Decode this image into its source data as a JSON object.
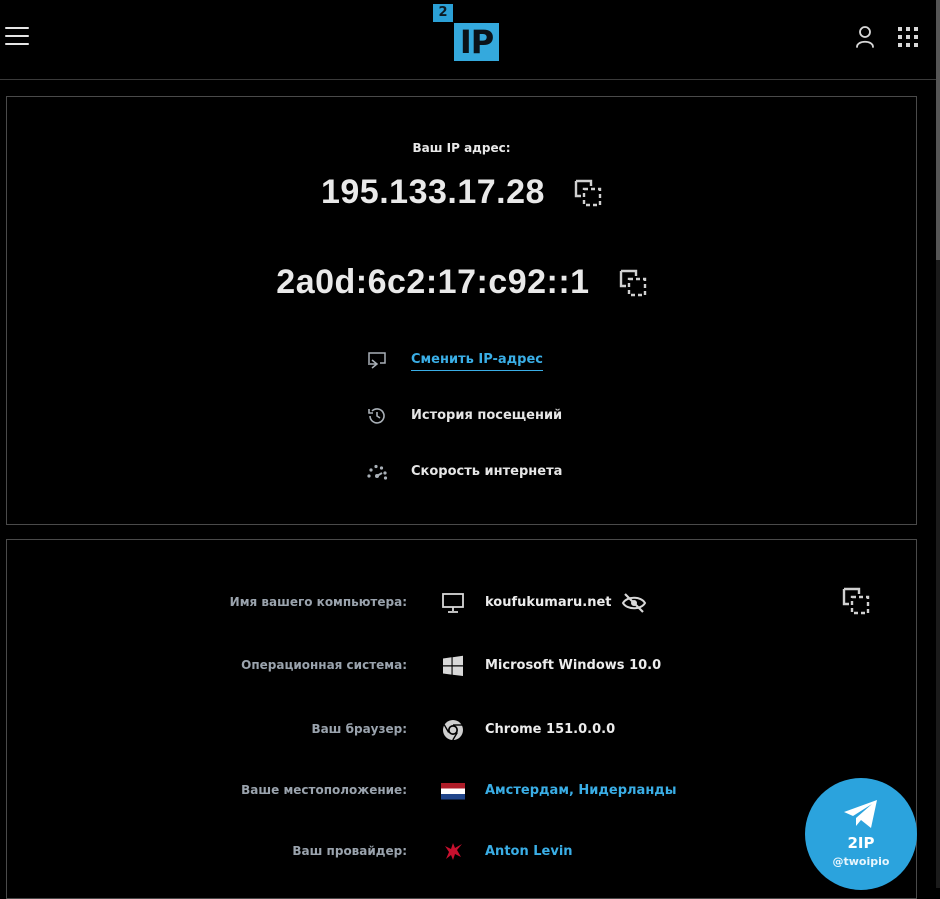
{
  "header": {
    "logo": {
      "small": "2",
      "big": "IP"
    }
  },
  "ip_block": {
    "label": "Ваш IP адрес:",
    "ipv4": "195.133.17.28",
    "ipv6": "2a0d:6c2:17:c92::1",
    "menu": [
      {
        "icon": "change-ip-icon",
        "label": "Сменить IP-адрес"
      },
      {
        "icon": "history-icon",
        "label": "История посещений"
      },
      {
        "icon": "speedometer-icon",
        "label": "Скорость интернета"
      }
    ]
  },
  "info": {
    "rows": [
      {
        "label": "Имя вашего компьютера:",
        "icon": "monitor-icon",
        "value": "koufukumaru.net"
      },
      {
        "label": "Операционная система:",
        "icon": "windows-icon",
        "value": "Microsoft Windows 10.0"
      },
      {
        "label": "Ваш браузер:",
        "icon": "chrome-icon",
        "value": "Chrome 151.0.0.0"
      },
      {
        "label": "Ваше местоположение:",
        "icon": "netherlands-flag-icon",
        "value": "Амстердам, Нидерланды"
      },
      {
        "label": "Ваш провайдер:",
        "icon": "provider-logo-icon",
        "value": "Anton Levin"
      }
    ]
  },
  "telegram": {
    "title": "2IP",
    "handle": "@twoipio"
  },
  "colors": {
    "accent": "#3aaee6",
    "logo": "#34a9dd",
    "background": "#000000",
    "border": "#4a4a4a"
  }
}
